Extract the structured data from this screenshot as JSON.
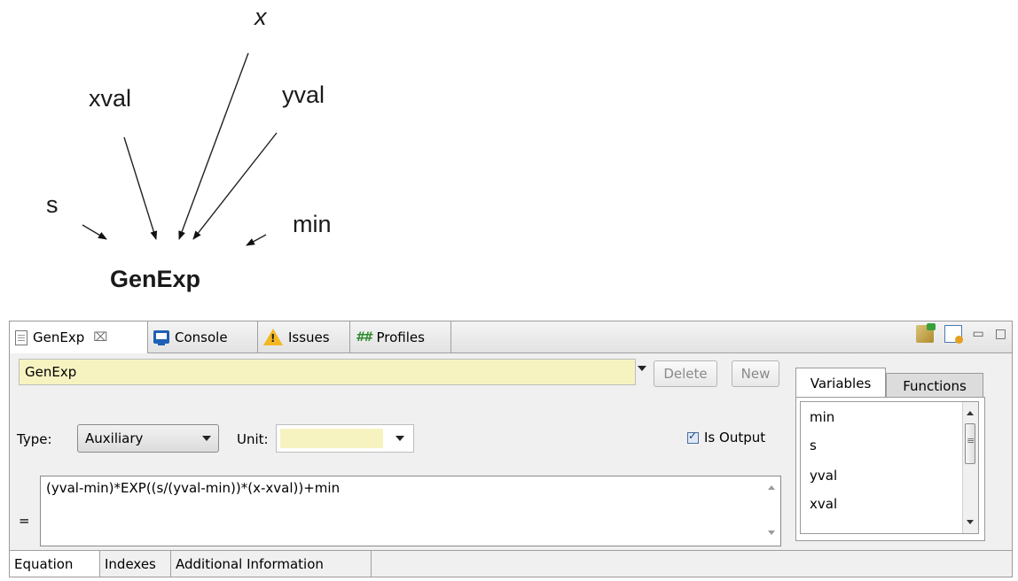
{
  "diagram": {
    "nodes": {
      "x": "x",
      "xval": "xval",
      "yval": "yval",
      "s": "s",
      "min": "min",
      "target": "GenExp"
    }
  },
  "tabs": [
    {
      "label": "GenExp",
      "icon": "document-icon",
      "active": true,
      "closable": true
    },
    {
      "label": "Console",
      "icon": "console-icon"
    },
    {
      "label": "Issues",
      "icon": "warning-icon"
    },
    {
      "label": "Profiles",
      "icon": "hash-icon",
      "icon_text": "##"
    }
  ],
  "toolbar": {
    "delete_label": "Delete",
    "new_label": "New"
  },
  "variable": {
    "name": "GenExp",
    "type_label": "Type:",
    "type_value": "Auxiliary",
    "unit_label": "Unit:",
    "unit_value": "",
    "is_output_label": "Is Output",
    "is_output": true,
    "equals": "=",
    "equation": "(yval-min)*EXP((s/(yval-min))*(x-xval))+min"
  },
  "side_panel": {
    "tabs": [
      "Variables",
      "Functions"
    ],
    "items": [
      "min",
      "s",
      "yval",
      "xval"
    ]
  },
  "bottom_tabs": [
    "Equation",
    "Indexes",
    "Additional Information"
  ],
  "window_controls": {
    "minimize": "▭",
    "maximize": "□"
  },
  "colors": {
    "field_highlight": "#f7f3c1",
    "panel_bg": "#f0f0f0",
    "check_blue": "#1a3f7a"
  }
}
